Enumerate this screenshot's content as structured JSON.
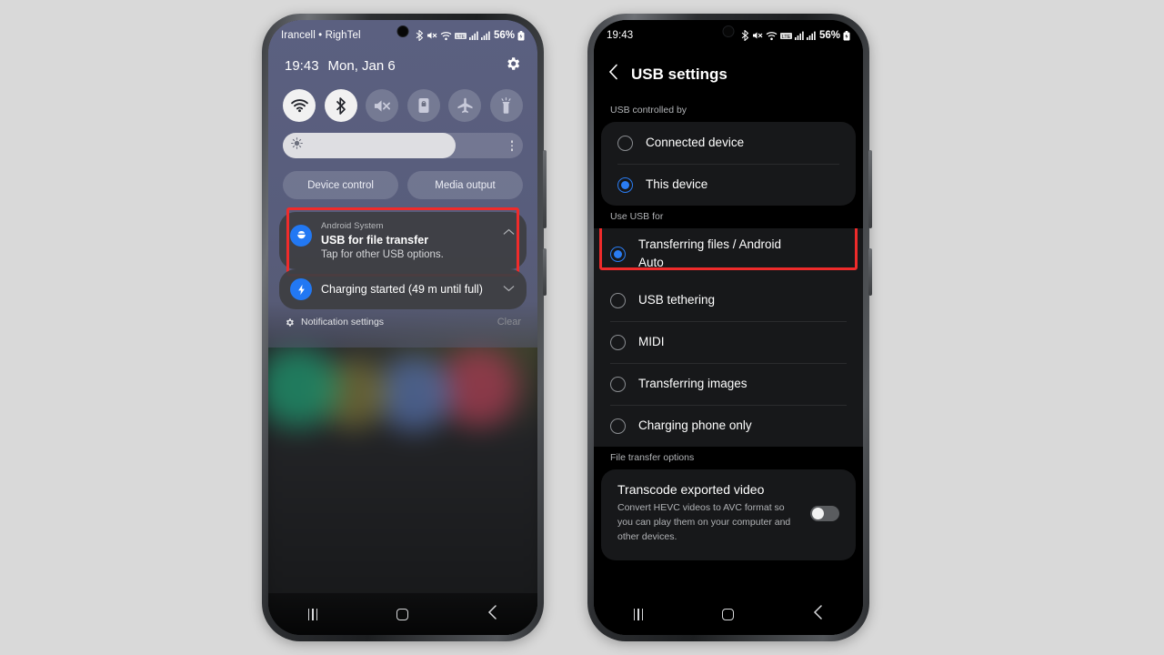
{
  "background_color": "#d9d9d9",
  "accent_blue": "#2a7cf2",
  "highlight_color": "#ef2b2b",
  "left_phone": {
    "status_bar": {
      "carrier": "Irancell • RighTel",
      "battery_percent": "56%",
      "icons": [
        "bluetooth-icon",
        "mute-icon",
        "wifi-icon",
        "lte-data-icon",
        "signal-bars-icon",
        "signal-bars-icon",
        "battery-icon"
      ]
    },
    "quick_settings": {
      "time": "19:43",
      "date": "Mon, Jan 6",
      "settings_icon": "gear-icon",
      "toggles": [
        {
          "name": "wifi-toggle",
          "icon": "wifi-icon",
          "active": true
        },
        {
          "name": "bluetooth-toggle",
          "icon": "bluetooth-icon",
          "active": true
        },
        {
          "name": "sound-toggle",
          "icon": "mute-icon",
          "active": false
        },
        {
          "name": "auto-rotate-toggle",
          "icon": "rotation-lock-icon",
          "active": false
        },
        {
          "name": "airplane-toggle",
          "icon": "airplane-icon",
          "active": false
        },
        {
          "name": "flashlight-toggle",
          "icon": "flashlight-icon",
          "active": false
        }
      ],
      "brightness": {
        "icon": "brightness-icon",
        "level_percent": 72,
        "menu_icon": "kebab-menu-icon"
      },
      "actions": [
        {
          "name": "device-control-button",
          "label": "Device control"
        },
        {
          "name": "media-output-button",
          "label": "Media output"
        }
      ]
    },
    "notifications": [
      {
        "name": "usb-notification",
        "icon": "usb-icon",
        "app": "Android System",
        "title": "USB for file transfer",
        "subtitle": "Tap for other USB options.",
        "expand_icon": "chevron-up-icon",
        "highlighted": true
      },
      {
        "name": "charging-notification",
        "icon": "charging-bolt-icon",
        "title": "Charging started (49 m until full)",
        "expand_icon": "chevron-down-icon",
        "highlighted": false
      }
    ],
    "notification_footer": {
      "gear_icon": "gear-icon",
      "settings_label": "Notification settings",
      "clear_label": "Clear"
    },
    "nav_bar": {
      "recents": "recents-icon",
      "home": "home-icon",
      "back": "back-icon"
    }
  },
  "right_phone": {
    "status_bar": {
      "time": "19:43",
      "battery_percent": "56%",
      "icons": [
        "bluetooth-icon",
        "mute-icon",
        "wifi-icon",
        "lte-data-icon",
        "signal-bars-icon",
        "signal-bars-icon",
        "battery-icon"
      ]
    },
    "header": {
      "back_icon": "back-chevron-icon",
      "title": "USB settings"
    },
    "sections": [
      {
        "name": "usb-controlled-by-section",
        "label": "USB controlled by",
        "options": [
          {
            "name": "option-connected-device",
            "label": "Connected device",
            "selected": false
          },
          {
            "name": "option-this-device",
            "label": "This device",
            "selected": true
          }
        ]
      },
      {
        "name": "use-usb-for-section",
        "label": "Use USB for",
        "options": [
          {
            "name": "option-transferring-files",
            "label": "Transferring files / Android Auto",
            "selected": true,
            "highlighted": true
          },
          {
            "name": "option-usb-tethering",
            "label": "USB tethering",
            "selected": false
          },
          {
            "name": "option-midi",
            "label": "MIDI",
            "selected": false
          },
          {
            "name": "option-transferring-images",
            "label": "Transferring images",
            "selected": false
          },
          {
            "name": "option-charging-phone-only",
            "label": "Charging phone only",
            "selected": false
          }
        ]
      }
    ],
    "file_transfer_options": {
      "label": "File transfer options",
      "transcode": {
        "name": "transcode-exported-video",
        "title": "Transcode exported video",
        "description": "Convert HEVC videos to AVC format so you can play them on your computer and other devices.",
        "toggle_on": false
      }
    },
    "nav_bar": {
      "recents": "recents-icon",
      "home": "home-icon",
      "back": "back-icon"
    }
  }
}
